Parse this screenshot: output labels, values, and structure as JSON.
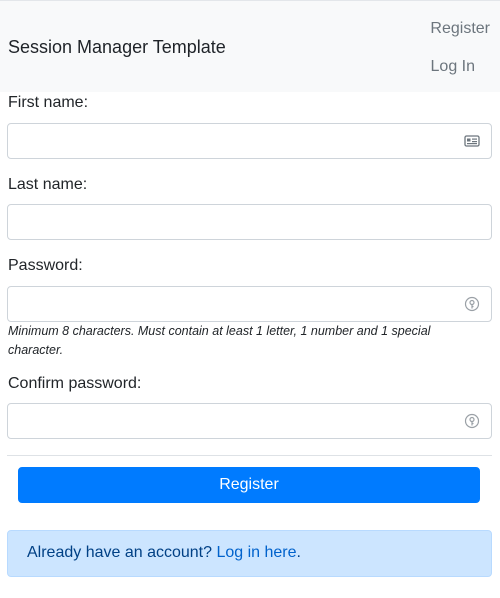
{
  "navbar": {
    "brand": "Session Manager Template",
    "links": {
      "register": "Register",
      "login": "Log In"
    }
  },
  "form": {
    "first_name": {
      "label": "First name:",
      "value": "",
      "icon": "contact-card-icon"
    },
    "last_name": {
      "label": "Last name:",
      "value": ""
    },
    "password": {
      "label": "Password:",
      "value": "",
      "icon": "password-key-icon",
      "hint": "Minimum 8 characters. Must contain at least 1 letter, 1 number and 1 special character."
    },
    "confirm_password": {
      "label": "Confirm password:",
      "value": "",
      "icon": "password-key-icon"
    },
    "submit_label": "Register"
  },
  "alert": {
    "text": "Already have an account? ",
    "link_text": "Log in here",
    "suffix": "."
  },
  "colors": {
    "primary": "#007bff",
    "navbar_bg": "#f8f9fa",
    "alert_bg": "#cce5ff",
    "alert_text": "#004085"
  }
}
